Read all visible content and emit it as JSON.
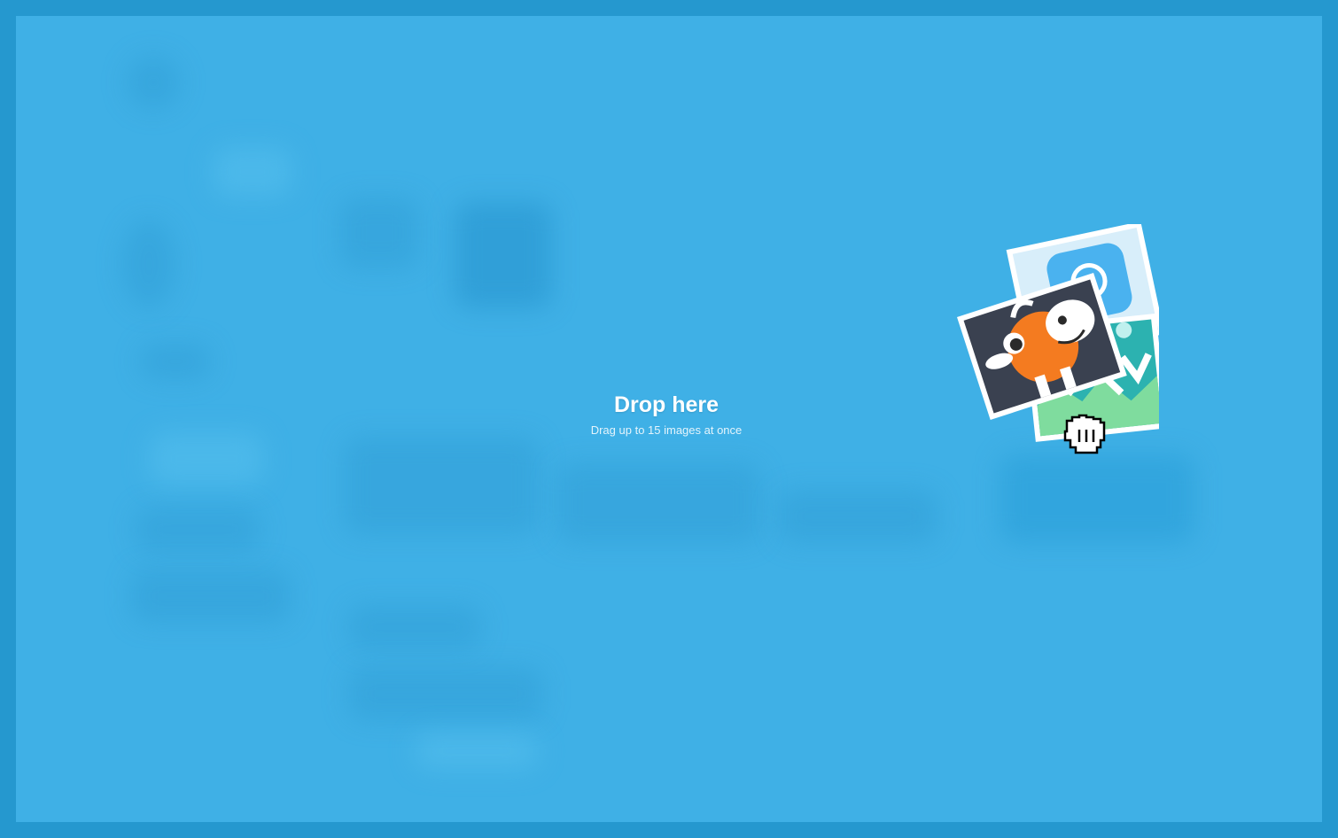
{
  "drop_zone": {
    "title": "Drop here",
    "subtitle": "Drag up to 15 images at once"
  },
  "illustration": {
    "icons": [
      "photo-stack-icon",
      "cow-mascot-icon",
      "grab-hand-cursor-icon"
    ]
  },
  "colors": {
    "frame": "#2598cf",
    "overlay": "#3fb0e6",
    "text": "#ffffff"
  }
}
